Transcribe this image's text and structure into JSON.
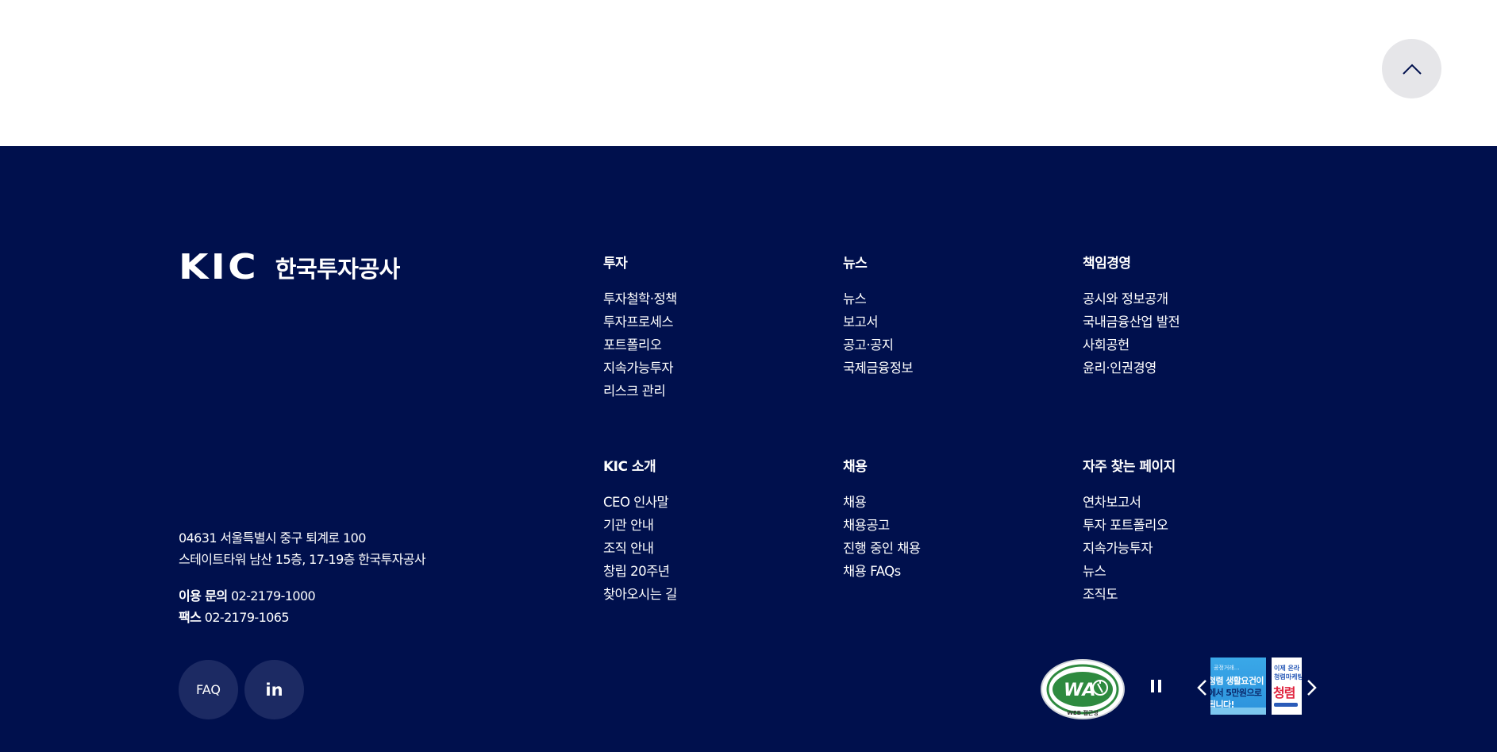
{
  "top_button": {
    "icon": "chevron-up-icon"
  },
  "logo": {
    "mark": "KIC",
    "name": "한국투자공사"
  },
  "menus": [
    {
      "title": "투자",
      "items": [
        "투자철학·정책",
        "투자프로세스",
        "포트폴리오",
        "지속가능투자",
        "리스크 관리"
      ]
    },
    {
      "title": "뉴스",
      "items": [
        "뉴스",
        "보고서",
        "공고·공지",
        "국제금융정보"
      ]
    },
    {
      "title": "책임경영",
      "items": [
        "공시와 정보공개",
        "국내금융산업 발전",
        "사회공헌",
        "윤리·인권경영"
      ]
    },
    {
      "title": "KIC 소개",
      "items": [
        "CEO 인사말",
        "기관 안내",
        "조직 안내",
        "창립 20주년",
        "찾아오시는 길"
      ]
    },
    {
      "title": "채용",
      "items": [
        "채용",
        "채용공고",
        "진행 중인 채용",
        "채용 FAQs"
      ]
    },
    {
      "title": "자주 찾는 페이지",
      "items": [
        "연차보고서",
        "투자 포트폴리오",
        "지속가능투자",
        "뉴스",
        "조직도"
      ]
    }
  ],
  "address": {
    "line1": "04631 서울특별시 중구 퇴계로 100",
    "line2": "스테이트타워 남산 15층, 17-19층 한국투자공사"
  },
  "contact": {
    "phone_label": "이용 문의",
    "phone": "02-2179-1000",
    "fax_label": "팩스",
    "fax": "02-2179-1065"
  },
  "buttons": {
    "faq": "FAQ",
    "linkedin": "in"
  },
  "badge": {
    "label": "WA",
    "sub": "WEB 접근성"
  },
  "banners": [
    {
      "small": "공정거래…",
      "line1": "청렴 생활요건이",
      "line2": "에서 5만원으로",
      "line3": "됩니다!"
    },
    {
      "s1": "이제 온라",
      "s2": "청렴마케팅",
      "s3": "청렴"
    }
  ],
  "colors": {
    "footer_bg": "#00104d",
    "circle_btn": "#1c2a63",
    "top_btn": "#e6e6e9"
  }
}
